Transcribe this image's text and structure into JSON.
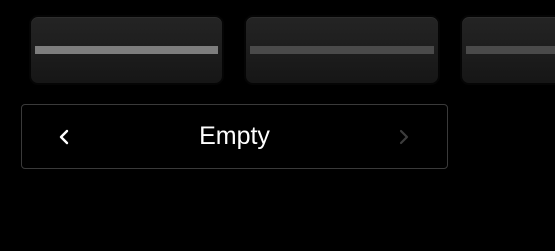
{
  "tabs": [
    {
      "id": "tab-1",
      "selected": true
    },
    {
      "id": "tab-2",
      "selected": false
    },
    {
      "id": "tab-3",
      "selected": false
    }
  ],
  "selector": {
    "value": "Empty",
    "prev_icon": "chevron-left-icon",
    "next_icon": "chevron-right-icon",
    "prev_enabled": true,
    "next_enabled": false
  },
  "colors": {
    "background": "#000000",
    "tab_face": "#1e1e1e",
    "tab_bar_selected": "#7d7d7d",
    "tab_bar": "#4a4a4a",
    "selector_border": "#3a3a3a",
    "text": "#ffffff",
    "chevron_enabled": "#ffffff",
    "chevron_disabled": "#3c3c3c"
  }
}
